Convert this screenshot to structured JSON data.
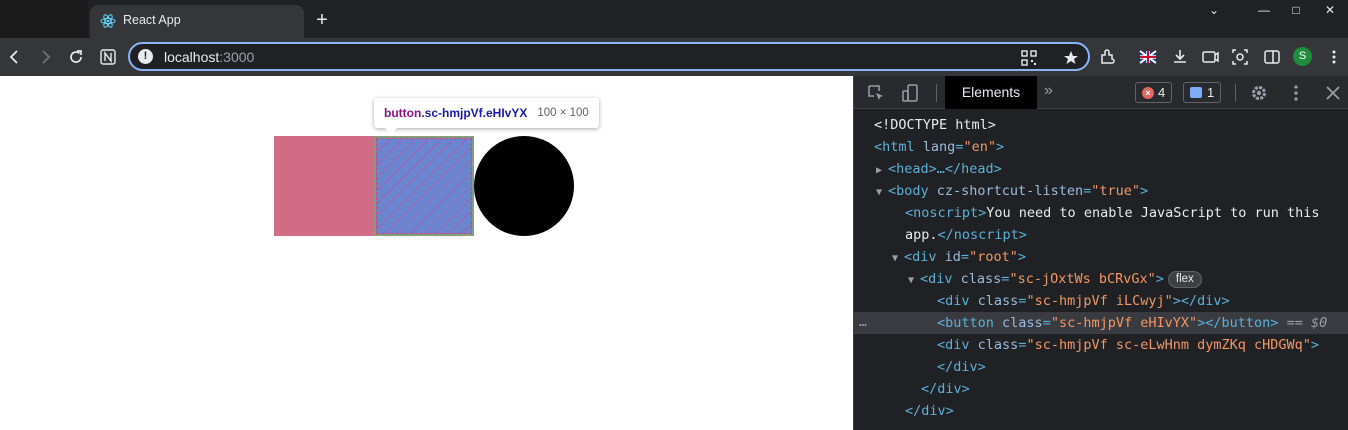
{
  "browser": {
    "tab_title": "React App",
    "new_tab": "+",
    "url_host": "localhost",
    "url_port": ":3000",
    "profile_initial": "S",
    "window_controls": [
      "⌄",
      "—",
      "□",
      "✕"
    ]
  },
  "page": {
    "tooltip_tag": "button",
    "tooltip_class": ".sc-hmjpVf.eHIvYX",
    "tooltip_dims": "100 × 100",
    "colors": {
      "pink": "#d16b86",
      "button": "#6c85d0",
      "circle": "#000000"
    }
  },
  "devtools": {
    "active_tab": "Elements",
    "more_tabs": "»",
    "errors_count": "4",
    "messages_count": "1",
    "dom": {
      "doctype": "<!DOCTYPE html>",
      "html_open": "<html",
      "html_attr": "lang",
      "html_val": "\"en\"",
      "head": "<head>…</head>",
      "body_attr": "cz-shortcut-listen",
      "body_val": "\"true\"",
      "noscript_text_1": "You need to enable JavaScript to run this",
      "noscript_text_2": "app.",
      "root_id": "\"root\"",
      "flex_div_class": "\"sc-jOxtWs bCRvGx\"",
      "flex_badge": "flex",
      "child1_class": "\"sc-hmjpVf iLCwyj\"",
      "button_class": "\"sc-hmjpVf eHIvYX\"",
      "button_ref": "== $0",
      "child3_class": "\"sc-hmjpVf sc-eLwHnm dymZKq cHDGWq\"",
      "dots": "…"
    }
  }
}
